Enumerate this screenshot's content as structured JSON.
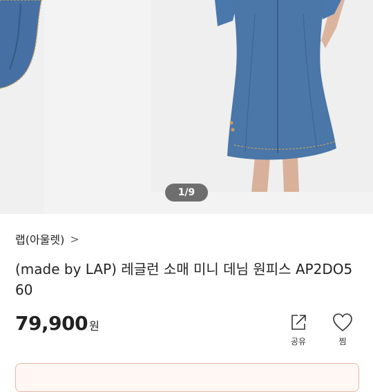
{
  "gallery": {
    "counter": "1/9"
  },
  "product": {
    "brand": "랩(아울렛)",
    "brand_chevron": ">",
    "title": "(made by LAP) 레글런 소매 미니 데님 원피스 AP2DO560",
    "price": "79,900",
    "currency": "원"
  },
  "actions": {
    "share_label": "공유",
    "wish_label": "찜"
  },
  "colors": {
    "denim": "#4a76a8",
    "accent_border": "#e9b7a3"
  }
}
